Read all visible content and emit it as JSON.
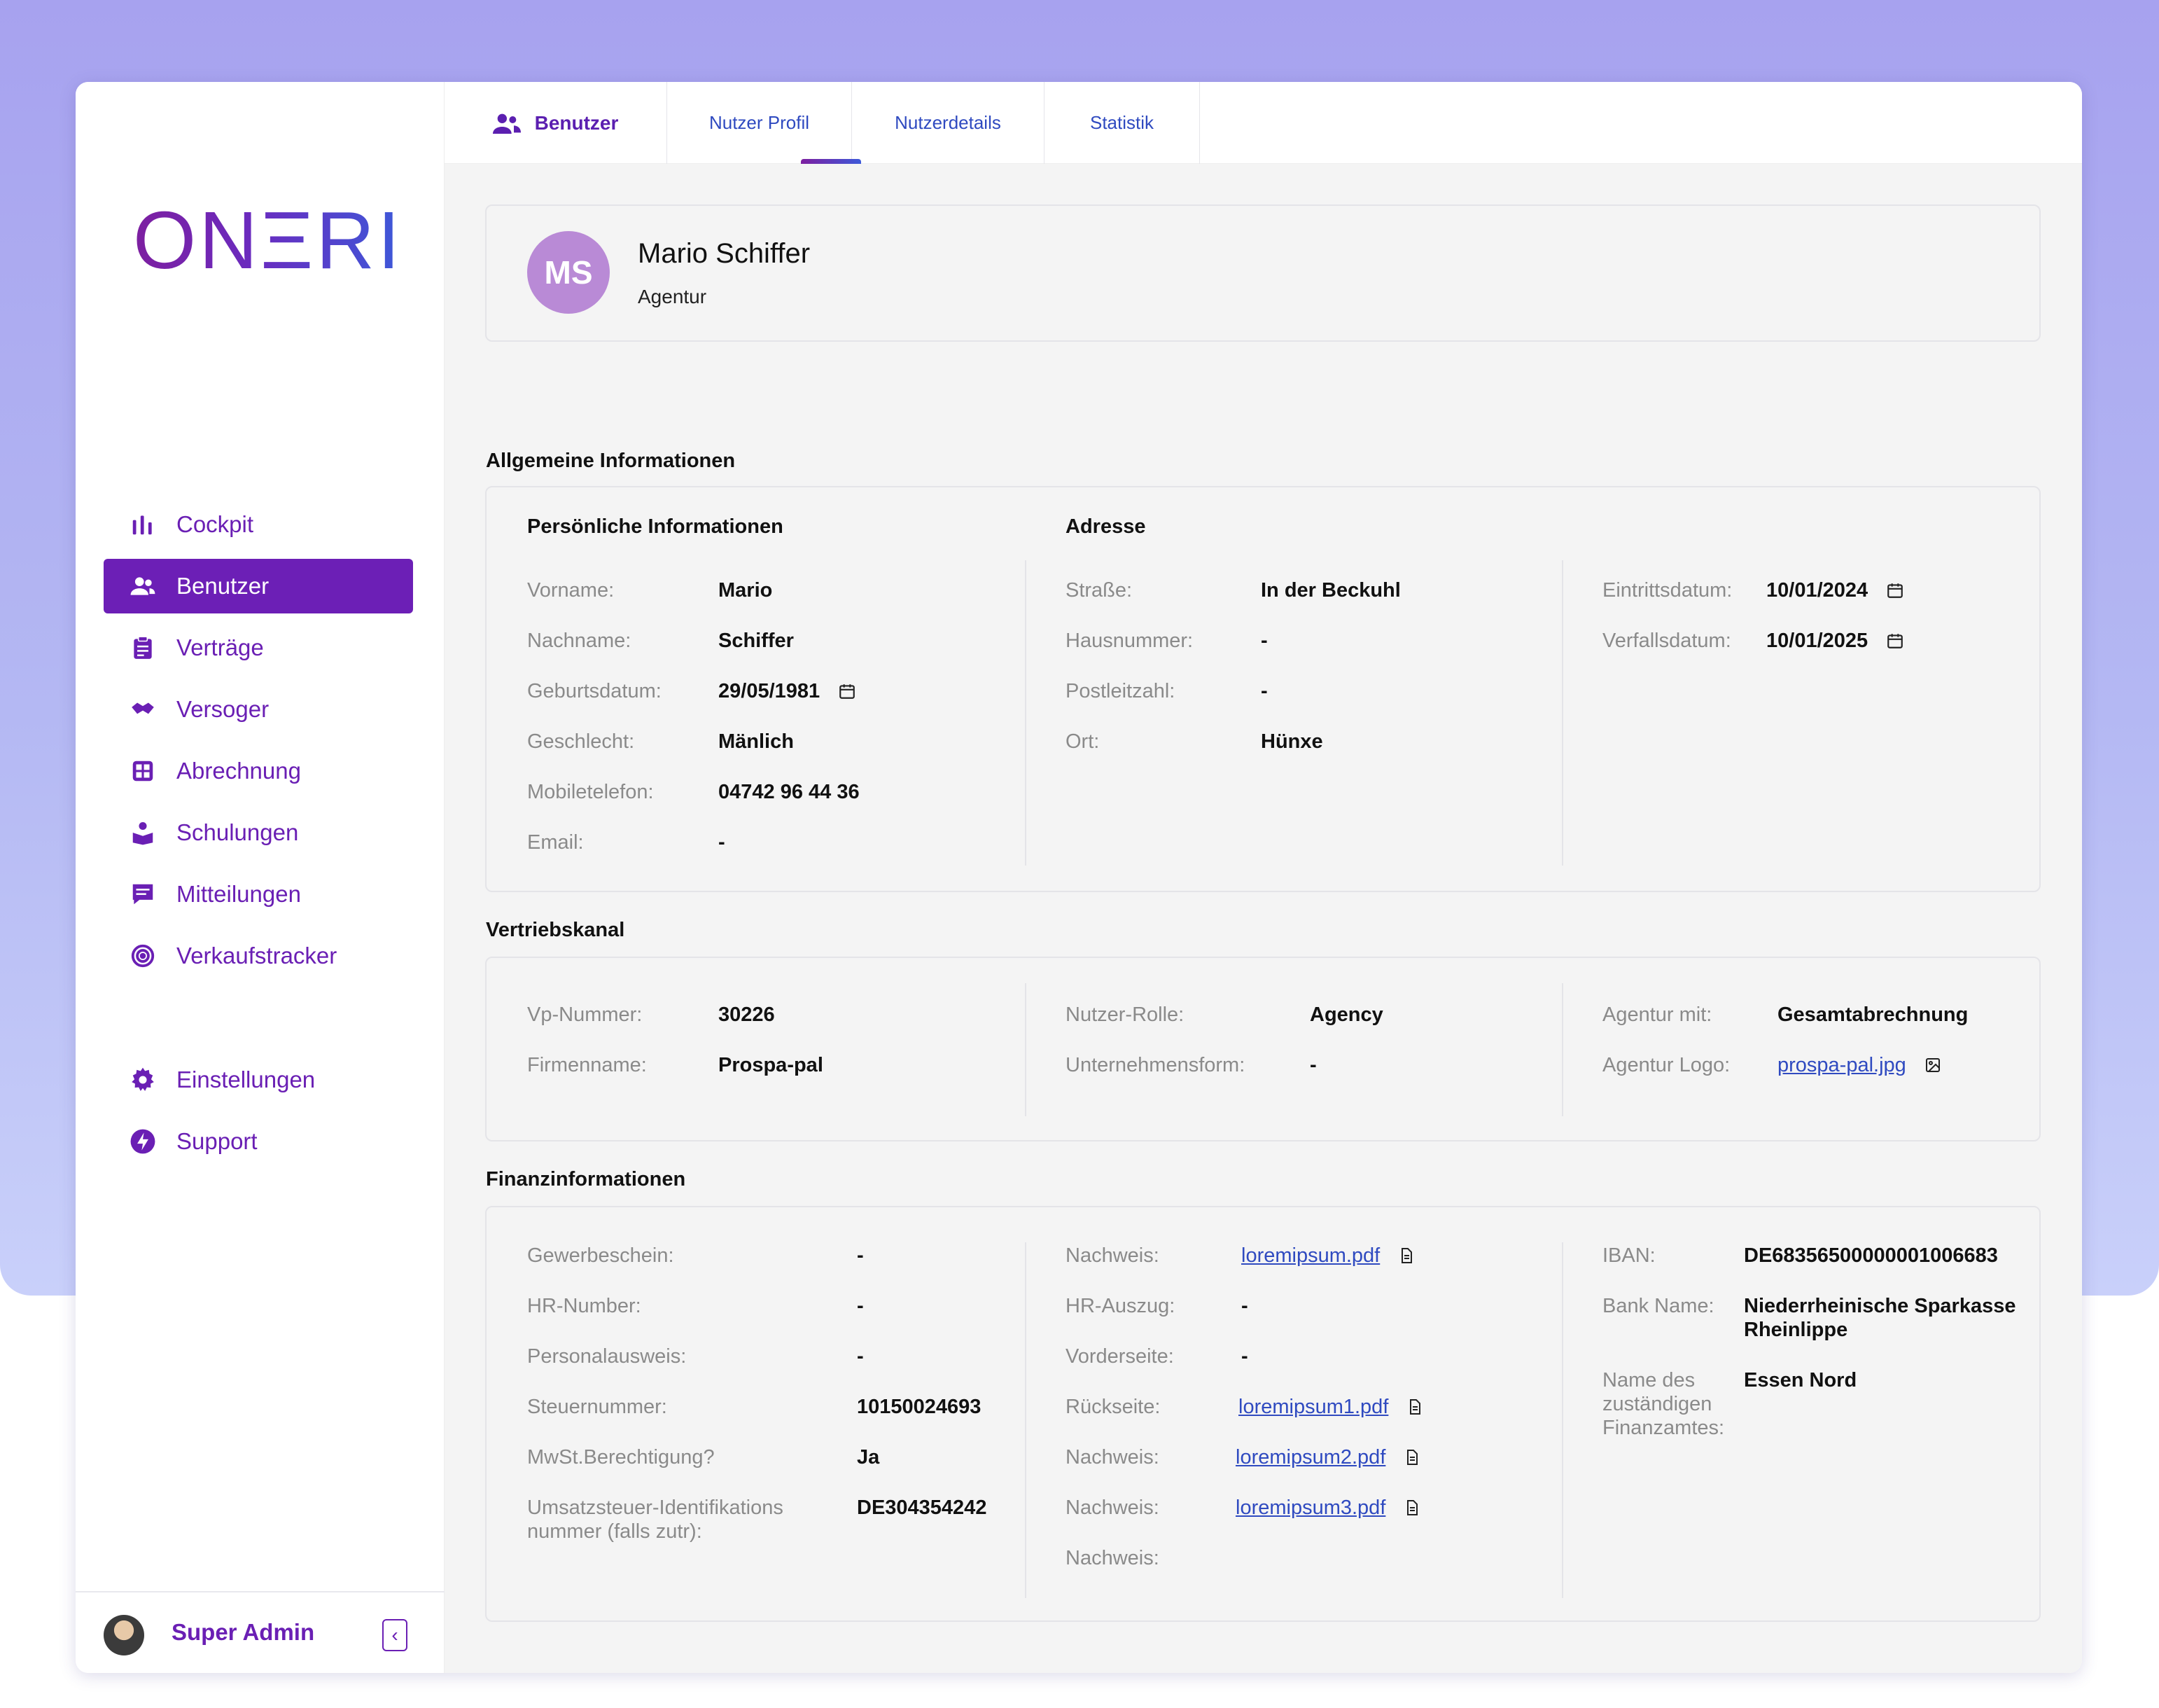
{
  "sidebar": {
    "logo": "ONΞRI",
    "nav": [
      {
        "label": "Cockpit",
        "icon": "bar-chart-icon"
      },
      {
        "label": "Benutzer",
        "icon": "users-icon",
        "active": true
      },
      {
        "label": "Verträge",
        "icon": "clipboard-icon"
      },
      {
        "label": "Versoger",
        "icon": "handshake-icon"
      },
      {
        "label": "Abrechnung",
        "icon": "calculator-icon"
      },
      {
        "label": "Schulungen",
        "icon": "training-icon"
      },
      {
        "label": "Mitteilungen",
        "icon": "message-icon"
      },
      {
        "label": "Verkaufstracker",
        "icon": "target-icon"
      }
    ],
    "bottom_nav": [
      {
        "label": "Einstellungen",
        "icon": "gear-icon"
      },
      {
        "label": "Support",
        "icon": "lightning-icon"
      }
    ],
    "user": {
      "name": "Super Admin",
      "collapse_icon": "chevron-left-icon"
    }
  },
  "tabs": {
    "section": "Benutzer",
    "items": [
      "Nutzer Profil",
      "Nutzerdetails",
      "Statistik"
    ],
    "active": "Nutzer Profil"
  },
  "profile": {
    "initials": "MS",
    "name": "Mario Schiffer",
    "role": "Agentur"
  },
  "allgemein": {
    "title": "Allgemeine Informationen",
    "persoenlich_title": "Persönliche Informationen",
    "adresse_title": "Adresse",
    "persoenlich": [
      {
        "label": "Vorname:",
        "value": "Mario"
      },
      {
        "label": "Nachname:",
        "value": "Schiffer"
      },
      {
        "label": "Geburtsdatum:",
        "value": "29/05/1981"
      },
      {
        "label": "Geschlecht:",
        "value": "Mänlich"
      },
      {
        "label": "Mobiletelefon:",
        "value": "04742 96 44 36"
      },
      {
        "label": "Email:",
        "value": "-"
      }
    ],
    "adresse": [
      {
        "label": "Straße:",
        "value": "In der Beckuhl"
      },
      {
        "label": "Hausnummer:",
        "value": "-"
      },
      {
        "label": "Postleitzahl:",
        "value": "-"
      },
      {
        "label": "Ort:",
        "value": "Hünxe"
      }
    ],
    "daten": [
      {
        "label": "Eintrittsdatum:",
        "value": "10/01/2024"
      },
      {
        "label": "Verfallsdatum:",
        "value": "10/01/2025"
      }
    ]
  },
  "vertrieb": {
    "title": "Vertriebskanal",
    "col1": [
      {
        "label": "Vp-Nummer:",
        "value": "30226"
      },
      {
        "label": "Firmenname:",
        "value": "Prospa-pal"
      }
    ],
    "col2": [
      {
        "label": "Nutzer-Rolle:",
        "value": "Agency"
      },
      {
        "label": "Unternehmensform:",
        "value": "-"
      }
    ],
    "col3": [
      {
        "label": "Agentur mit:",
        "value": "Gesamtabrechnung"
      },
      {
        "label": "Agentur Logo:",
        "value": "prospa-pal.jpg"
      }
    ]
  },
  "finanz": {
    "title": "Finanzinformationen",
    "col1": [
      {
        "label": "Gewerbeschein:",
        "value": "-"
      },
      {
        "label": "HR-Number:",
        "value": "-"
      },
      {
        "label": "Personalausweis:",
        "value": "-"
      },
      {
        "label": "Steuernummer:",
        "value": "10150024693"
      },
      {
        "label": "MwSt.Berechtigung?",
        "value": "Ja"
      },
      {
        "label": "Umsatzsteuer-Identifikations nummer (falls zutr):",
        "value": "DE304354242"
      }
    ],
    "col2": [
      {
        "label": "Nachweis:",
        "value": "loremipsum.pdf"
      },
      {
        "label": "HR-Auszug:",
        "value": "-"
      },
      {
        "label": "Vorderseite:",
        "value": "-"
      },
      {
        "label": "Rückseite:",
        "value": "loremipsum1.pdf"
      },
      {
        "label": "Nachweis:",
        "value": "loremipsum2.pdf"
      },
      {
        "label": "Nachweis:",
        "value": "loremipsum3.pdf"
      },
      {
        "label": "Nachweis:",
        "value": ""
      }
    ],
    "col3": [
      {
        "label": "IBAN:",
        "value": "DE68356500000001006683"
      },
      {
        "label": "Bank Name:",
        "value": "Niederrheinische Sparkasse Rheinlippe"
      },
      {
        "label": "Name des zuständigen Finanzamtes:",
        "value": "Essen Nord"
      }
    ]
  },
  "colors": {
    "brand": "#6c1fb6",
    "link": "#2f4ac0",
    "background_gradient": [
      "#a7a2ef",
      "#c9d0fa"
    ]
  }
}
